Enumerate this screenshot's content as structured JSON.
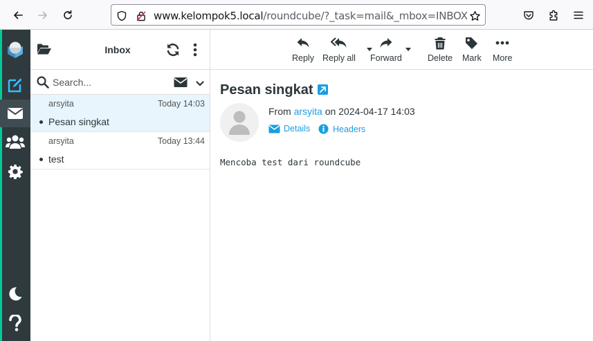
{
  "browser": {
    "url_host": "www.kelompok5.local",
    "url_path": "/roundcube/?_task=mail&_mbox=INBOX"
  },
  "list": {
    "title": "Inbox",
    "search_placeholder": "Search...",
    "messages": [
      {
        "from": "arsyita",
        "date": "Today 14:03",
        "subject": "Pesan singkat"
      },
      {
        "from": "arsyita",
        "date": "Today 13:44",
        "subject": "test"
      }
    ]
  },
  "toolbar": {
    "reply": "Reply",
    "reply_all": "Reply all",
    "forward": "Forward",
    "delete": "Delete",
    "mark": "Mark",
    "more": "More"
  },
  "message": {
    "subject": "Pesan singkat",
    "from_prefix": "From",
    "from_name": "arsyita",
    "on_date": "on 2024-04-17 14:03",
    "details_label": "Details",
    "headers_label": "Headers",
    "body": "Mencoba test dari roundcube"
  },
  "colors": {
    "accent": "#00cc99",
    "link": "#1a9ee2",
    "sidebar_bg": "#2f3a3f",
    "selected_row": "#e8f5fc"
  }
}
